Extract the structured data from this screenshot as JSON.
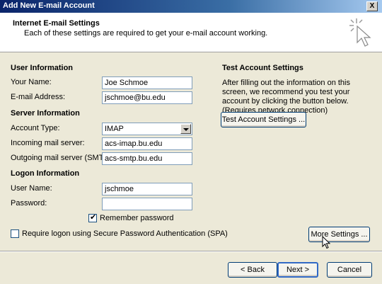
{
  "window": {
    "title": "Add New E-mail Account",
    "close_glyph": "X"
  },
  "header": {
    "title": "Internet E-mail Settings",
    "subtitle": "Each of these settings are required to get your e-mail account working."
  },
  "user_info": {
    "heading": "User Information",
    "name_label": "Your Name:",
    "name_value": "Joe Schmoe",
    "email_label": "E-mail Address:",
    "email_value": "jschmoe@bu.edu"
  },
  "server_info": {
    "heading": "Server Information",
    "account_type_label": "Account Type:",
    "account_type_value": "IMAP",
    "incoming_label": "Incoming mail server:",
    "incoming_value": "acs-imap.bu.edu",
    "outgoing_label": "Outgoing mail server (SMTP):",
    "outgoing_value": "acs-smtp.bu.edu"
  },
  "logon_info": {
    "heading": "Logon Information",
    "username_label": "User Name:",
    "username_value": "jschmoe",
    "password_label": "Password:",
    "password_value": "",
    "remember_label": "Remember password",
    "remember_checked": true,
    "spa_label": "Require logon using Secure Password Authentication (SPA)",
    "spa_checked": false
  },
  "test_settings": {
    "heading": "Test Account Settings",
    "description": "After filling out the information on this screen, we recommend you test your account by clicking the button below. (Requires network connection)",
    "button_label": "Test Account Settings ..."
  },
  "buttons": {
    "more_settings": "More Settings ...",
    "back": "< Back",
    "next": "Next >",
    "cancel": "Cancel"
  },
  "icons": {
    "wizard": "sparkle-cursor-icon",
    "pointer": "mouse-pointer-icon"
  },
  "colors": {
    "title_bar": "#0a246a",
    "dialog_bg": "#ece9d8",
    "button_border": "#003c74",
    "default_button": "#3169c6"
  }
}
